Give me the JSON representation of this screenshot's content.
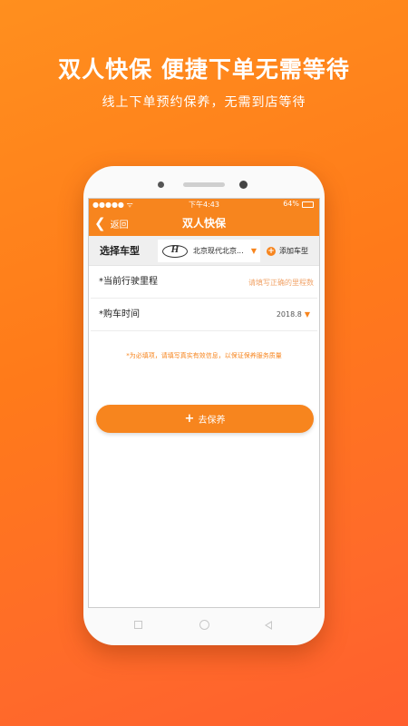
{
  "promo": {
    "title": "双人快保 便捷下单无需等待",
    "subtitle": "线上下单预约保养，无需到店等待"
  },
  "statusbar": {
    "signal": "●●●●● ᯤ",
    "time": "下午4:43",
    "battery": "64%",
    "battery_level": 0.64
  },
  "navbar": {
    "back_label": "返回",
    "title": "双人快保"
  },
  "car": {
    "label": "选择车型",
    "brand_icon": "hyundai-logo",
    "selected": "北京现代北京...",
    "add_label": "添加车型"
  },
  "form": {
    "mileage_label": "*当前行驶里程",
    "mileage_placeholder": "请填写正确的里程数",
    "mileage_value": "",
    "purchase_label": "*购车时间",
    "purchase_value": "2018.8"
  },
  "notice": "*为必填项，请填写真实有效信息，以保证保养服务质量",
  "go_button": "去保养",
  "colors": {
    "accent": "#f7851e",
    "background_start": "#ff8f1e",
    "background_end": "#ff5f2e"
  }
}
